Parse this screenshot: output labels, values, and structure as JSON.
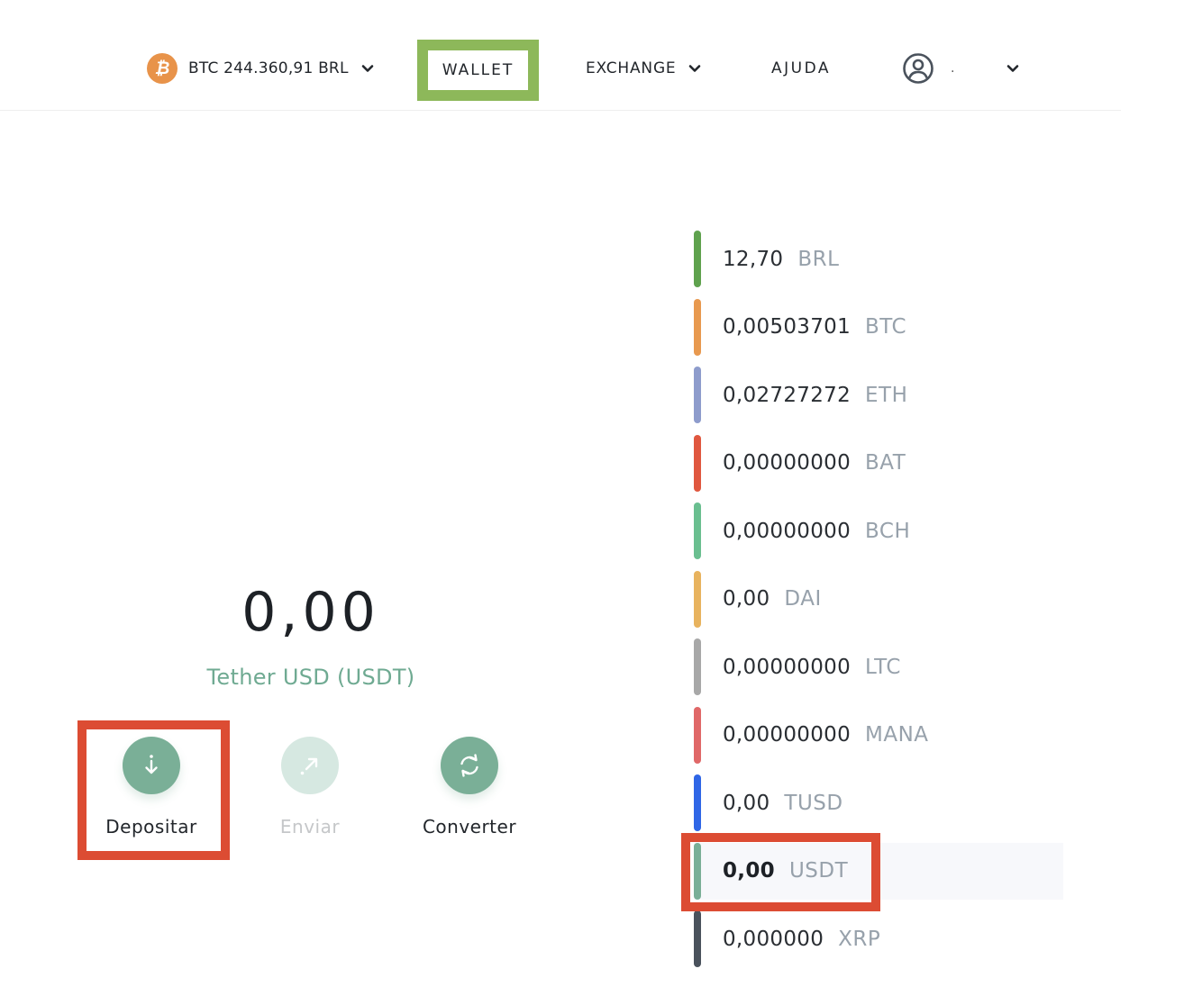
{
  "header": {
    "ticker": {
      "icon": "bitcoin-icon",
      "symbol_glyph": "₿",
      "text": "BTC 244.360,91 BRL",
      "color": "#e8934a"
    },
    "nav": {
      "wallet": "WALLET",
      "exchange": "EXCHANGE",
      "help": "AJUDA"
    },
    "user": {
      "icon": "user-avatar-icon",
      "name": "."
    },
    "highlight_color": "#8db85a"
  },
  "main": {
    "balance": "0,00",
    "currency_label": "Tether USD (USDT)",
    "actions": [
      {
        "label": "Depositar",
        "icon": "arrow-down-icon",
        "enabled": true
      },
      {
        "label": "Enviar",
        "icon": "arrow-up-right-icon",
        "enabled": false
      },
      {
        "label": "Converter",
        "icon": "refresh-icon",
        "enabled": true
      }
    ]
  },
  "wallets": [
    {
      "amount": "12,70",
      "code": "BRL",
      "color": "#5fa24e"
    },
    {
      "amount": "0,00503701",
      "code": "BTC",
      "color": "#e8994f"
    },
    {
      "amount": "0,02727272",
      "code": "ETH",
      "color": "#8e9ccc"
    },
    {
      "amount": "0,00000000",
      "code": "BAT",
      "color": "#e0573f"
    },
    {
      "amount": "0,00000000",
      "code": "BCH",
      "color": "#6abf90"
    },
    {
      "amount": "0,00",
      "code": "DAI",
      "color": "#e8b35e"
    },
    {
      "amount": "0,00000000",
      "code": "LTC",
      "color": "#a8a8a8"
    },
    {
      "amount": "0,00000000",
      "code": "MANA",
      "color": "#e06868"
    },
    {
      "amount": "0,00",
      "code": "TUSD",
      "color": "#2f66e6"
    },
    {
      "amount": "0,00",
      "code": "USDT",
      "color": "#7aaf97",
      "selected": true
    },
    {
      "amount": "0,000000",
      "code": "XRP",
      "color": "#4a525c"
    }
  ],
  "annotation_color": "#dc4c33"
}
